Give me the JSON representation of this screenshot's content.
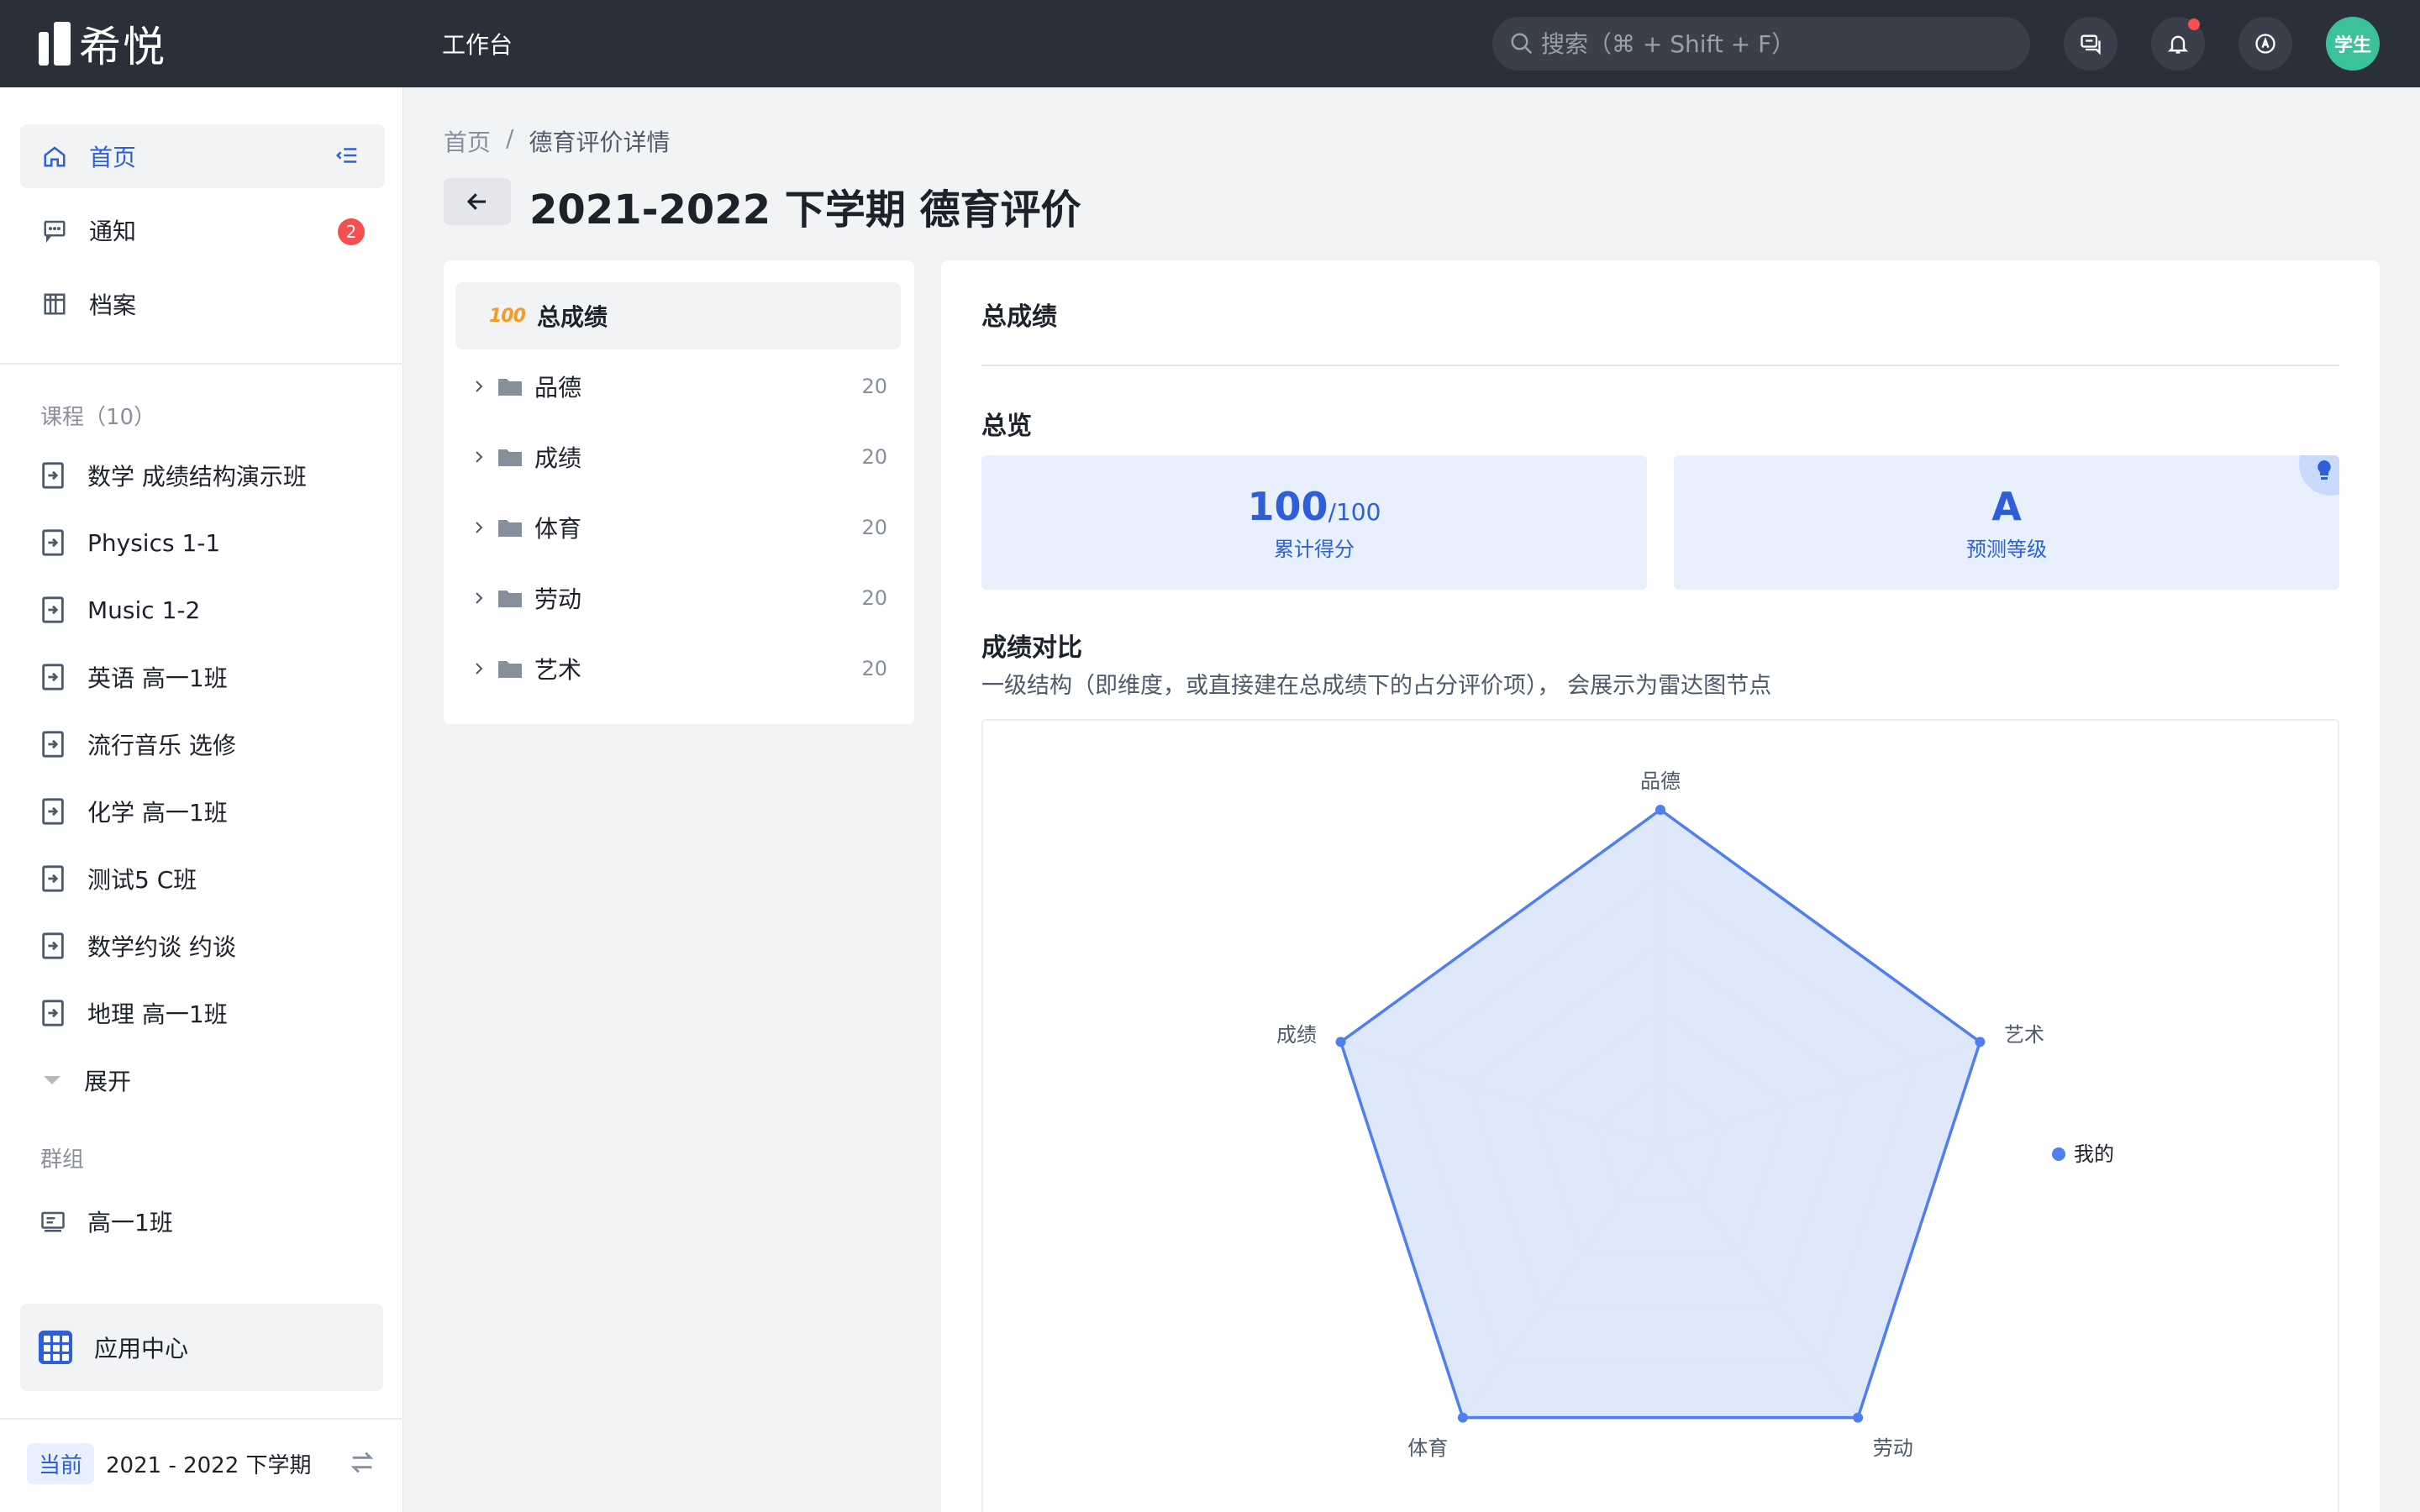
{
  "topbar": {
    "brand": "希悦",
    "nav_label": "工作台",
    "search_placeholder": "搜索（⌘ + Shift + F）",
    "avatar_label": "学生"
  },
  "sidebar": {
    "nav": [
      {
        "label": "首页",
        "icon": "home-icon"
      },
      {
        "label": "通知",
        "icon": "message-icon",
        "badge": "2"
      },
      {
        "label": "档案",
        "icon": "archive-icon"
      }
    ],
    "courses_title": "课程（10）",
    "courses": [
      "数学 成绩结构演示班",
      "Physics 1-1",
      "Music 1-2",
      "英语 高一1班",
      "流行音乐 选修",
      "化学 高一1班",
      "测试5 C班",
      "数学约谈 约谈",
      "地理 高一1班"
    ],
    "expand_label": "展开",
    "groups_title": "群组",
    "groups": [
      "高一1班"
    ],
    "app_center": "应用中心",
    "term_tag": "当前",
    "term_label": "2021 - 2022 下学期"
  },
  "breadcrumb": [
    "首页",
    "/",
    "德育评价详情"
  ],
  "page_title": "2021-2022 下学期 德育评价",
  "tree": {
    "root": {
      "label": "总成绩",
      "icon_text": "100"
    },
    "items": [
      {
        "label": "品德",
        "count": "20"
      },
      {
        "label": "成绩",
        "count": "20"
      },
      {
        "label": "体育",
        "count": "20"
      },
      {
        "label": "劳动",
        "count": "20"
      },
      {
        "label": "艺术",
        "count": "20"
      }
    ]
  },
  "content": {
    "header": "总成绩",
    "overview_title": "总览",
    "score": {
      "value": "100",
      "max": "/100",
      "label": "累计得分"
    },
    "grade": {
      "value": "A",
      "label": "预测等级"
    },
    "compare_title": "成绩对比",
    "compare_desc": "一级结构（即维度，或直接建在总成绩下的占分评价项）， 会展示为雷达图节点"
  },
  "colors": {
    "accent": "#2f5fd8",
    "radar_line": "#4e7ef0",
    "radar_fill": "#dbe4fb",
    "topbar": "#2b2f3a",
    "avatar": "#3cc29a",
    "badge": "#f5504e"
  },
  "chart_data": {
    "type": "radar",
    "indicators": [
      "品德",
      "艺术",
      "劳动",
      "体育",
      "成绩"
    ],
    "series": [
      {
        "name": "我的",
        "values": [
          20,
          20,
          20,
          20,
          20
        ]
      }
    ],
    "max": 20,
    "rings": 5,
    "legend_position": "right"
  }
}
